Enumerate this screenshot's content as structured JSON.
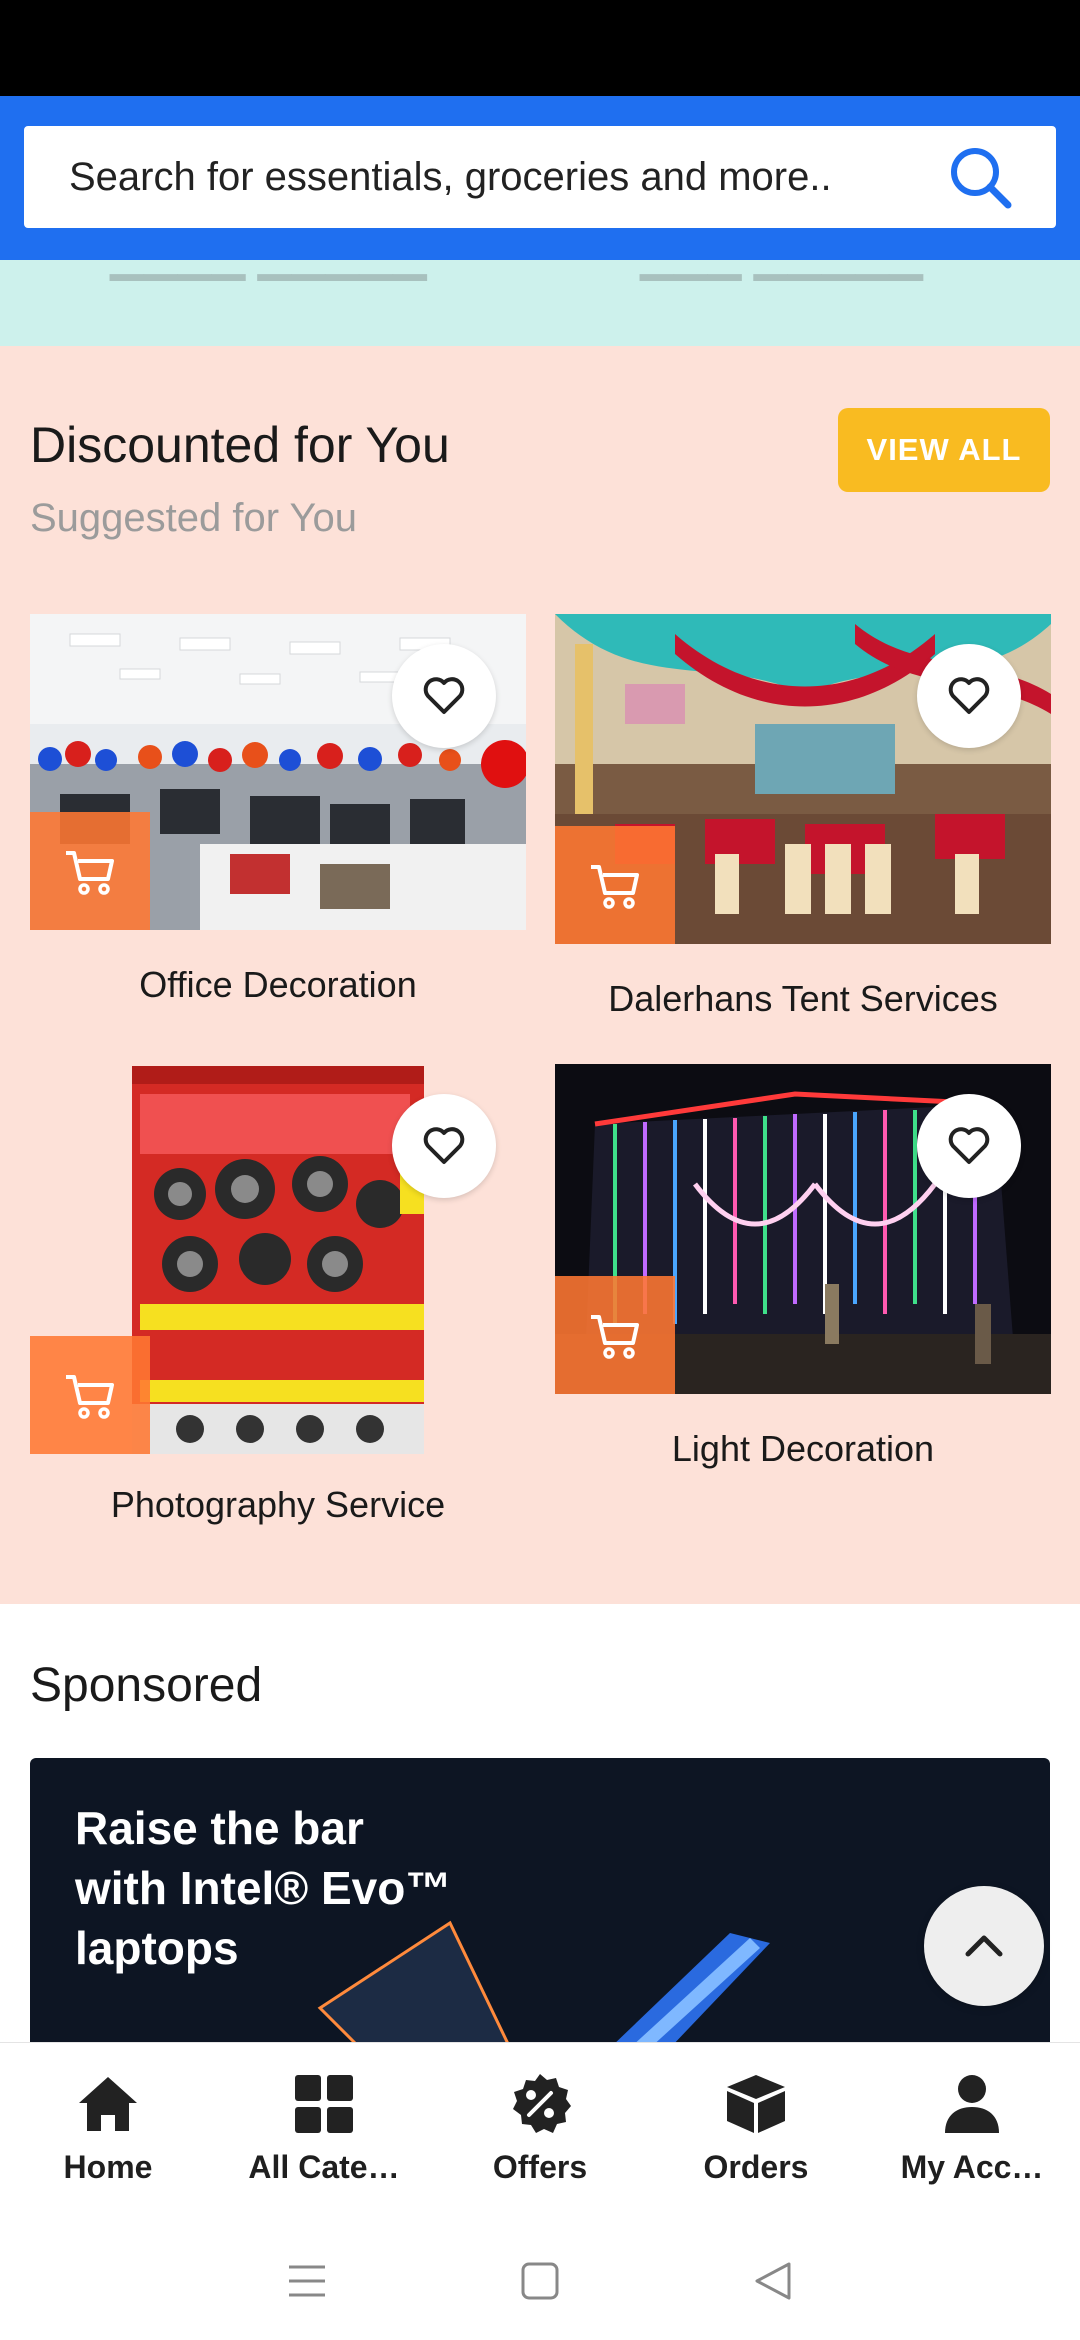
{
  "search": {
    "placeholder": "Search for essentials, groceries and more.."
  },
  "discounts": {
    "title": "Discounted for You",
    "subtitle": "Suggested for You",
    "view_all": "VIEW ALL",
    "items": [
      {
        "label": "Office Decoration"
      },
      {
        "label": "Dalerhans Tent Services"
      },
      {
        "label": "Photography Service"
      },
      {
        "label": "Light Decoration"
      }
    ]
  },
  "sponsored": {
    "title": "Sponsored",
    "banner_text": "Raise the bar\nwith Intel® Evo™\nlaptops"
  },
  "bottom_nav": [
    {
      "label": "Home",
      "icon": "home-icon"
    },
    {
      "label": "All Cate…",
      "icon": "grid-icon"
    },
    {
      "label": "Offers",
      "icon": "percent-badge-icon"
    },
    {
      "label": "Orders",
      "icon": "box-icon"
    },
    {
      "label": "My Acc…",
      "icon": "user-icon"
    }
  ],
  "colors": {
    "header_blue": "#1f6ff0",
    "section_bg": "#fde1d8",
    "view_all_bg": "#f9bb21",
    "cart_orange": "#ff7832",
    "teal_strip": "#cdf1ec"
  }
}
